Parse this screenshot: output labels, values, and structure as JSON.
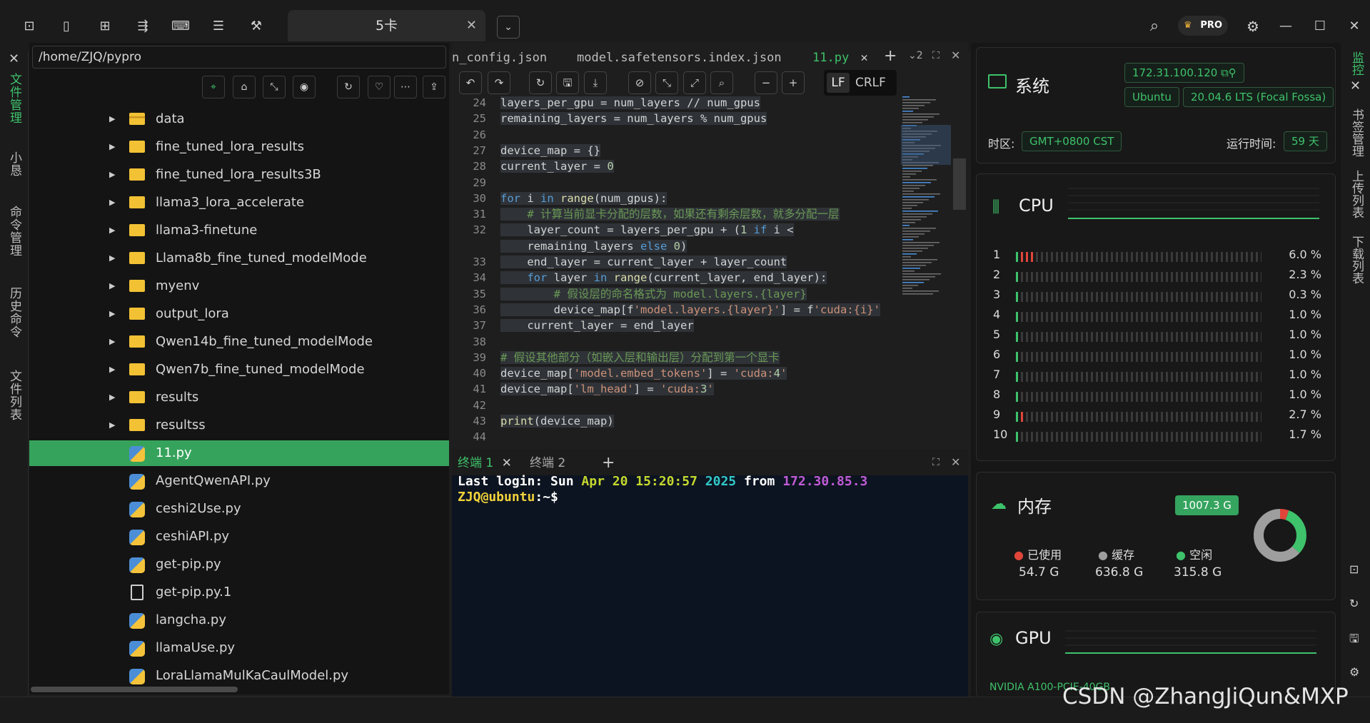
{
  "topbar": {
    "icons": [
      "terminal-icon",
      "bookmark-icon",
      "grid-icon",
      "tree-icon",
      "console-icon",
      "list-icon",
      "wrench-icon"
    ],
    "tab_label": "5卡",
    "tab_close": "✕",
    "menu_toggle": "⌄",
    "right_icons": [
      "search-icon",
      "pro-badge",
      "gear-icon",
      "minimize-icon",
      "maximize-icon",
      "close-icon"
    ],
    "pro_label": "PRO"
  },
  "left_rail": {
    "close": "✕",
    "items": [
      "文件管理",
      "小恳",
      "命令管理",
      "历史命令",
      "文件列表"
    ]
  },
  "file_panel": {
    "path": "/home/ZJQ/pypro",
    "toolbar": [
      "⌖",
      "⌂",
      "⤡",
      "◉",
      "↻",
      "♡",
      "⋯",
      "⇪"
    ],
    "items": [
      {
        "name": "data",
        "type": "db"
      },
      {
        "name": "fine_tuned_lora_results",
        "type": "folder"
      },
      {
        "name": "fine_tuned_lora_results3B",
        "type": "folder"
      },
      {
        "name": "llama3_lora_accelerate",
        "type": "folder"
      },
      {
        "name": "llama3-finetune",
        "type": "folder"
      },
      {
        "name": "Llama8b_fine_tuned_modelMode",
        "type": "folder"
      },
      {
        "name": "myenv",
        "type": "folder"
      },
      {
        "name": "output_lora",
        "type": "folder"
      },
      {
        "name": "Qwen14b_fine_tuned_modelMode",
        "type": "folder"
      },
      {
        "name": "Qwen7b_fine_tuned_modelMode",
        "type": "folder"
      },
      {
        "name": "results",
        "type": "folder"
      },
      {
        "name": "resultss",
        "type": "folder"
      },
      {
        "name": "11.py",
        "type": "py",
        "selected": true
      },
      {
        "name": "AgentQwenAPI.py",
        "type": "py"
      },
      {
        "name": "ceshi2Use.py",
        "type": "py"
      },
      {
        "name": "ceshiAPI.py",
        "type": "py"
      },
      {
        "name": "get-pip.py",
        "type": "py"
      },
      {
        "name": "get-pip.py.1",
        "type": "doc"
      },
      {
        "name": "langcha.py",
        "type": "py"
      },
      {
        "name": "llamaUse.py",
        "type": "py"
      },
      {
        "name": "LoraLlamaMulKaCaulModel.py",
        "type": "py"
      }
    ]
  },
  "editor": {
    "tabs": [
      "n_config.json",
      "model.safetensors.index.json",
      "11.py"
    ],
    "tab_close": "✕",
    "add": "+",
    "split": "⌄2",
    "expand": "⛶",
    "close": "✕",
    "toolbar": [
      "↶",
      "↷",
      "↻",
      "🖫",
      "⤓",
      "⊘",
      "⤡",
      "⤢",
      "⌕",
      "−",
      "+"
    ],
    "eol": [
      "LF",
      "CRLF"
    ],
    "lines": {
      "24": "layers_per_gpu = num_layers // num_gpus",
      "25": "remaining_layers = num_layers % num_gpus",
      "27": "device_map = {}",
      "28": "current_layer = 0",
      "30": "for i in range(num_gpus):",
      "31": "    # 计算当前显卡分配的层数，如果还有剩余层数，就多分配一层",
      "32a": "    layer_count = layers_per_gpu + (1 if i <",
      "32b": "    remaining_layers else 0)",
      "33": "    end_layer = current_layer + layer_count",
      "34": "    for layer in range(current_layer, end_layer):",
      "35": "        # 假设层的命名格式为 model.layers.{layer}",
      "36": "        device_map[f'model.layers.{layer}'] = f'cuda:{i}'",
      "37": "    current_layer = end_layer",
      "39": "# 假设其他部分（如嵌入层和输出层）分配到第一个显卡",
      "40": "device_map['model.embed_tokens'] = 'cuda:4'",
      "41": "device_map['lm_head'] = 'cuda:3'",
      "43": "print(device_map)"
    },
    "line_numbers": [
      "24",
      "25",
      "26",
      "27",
      "28",
      "29",
      "30",
      "31",
      "32",
      "",
      "33",
      "34",
      "35",
      "36",
      "37",
      "38",
      "39",
      "40",
      "41",
      "42",
      "43",
      "44"
    ]
  },
  "terminal": {
    "tabs": [
      "终端 1",
      "终端 2"
    ],
    "close": "✕",
    "add": "+",
    "login_prefix": "Last login: Sun ",
    "login_date": "Apr 20 15:20:57",
    "login_year": "2025",
    "login_from": " from ",
    "login_ip": "172.30.85.3",
    "prompt_user": "ZJQ@ubuntu",
    "prompt_path": ":~$"
  },
  "monitor": {
    "system_title": "系统",
    "ip": "172.31.100.120",
    "os": "Ubuntu",
    "os_version": "20.04.6 LTS (Focal Fossa)",
    "tz_label": "时区:",
    "tz_value": "GMT+0800  CST",
    "uptime_label": "运行时间:",
    "uptime_value": "59 天",
    "cpu_title": "CPU",
    "cpu_cores": [
      {
        "id": "1",
        "pct": "6.0 %",
        "level": 0.06,
        "hot": true
      },
      {
        "id": "2",
        "pct": "2.3 %",
        "level": 0.023,
        "hot": true
      },
      {
        "id": "3",
        "pct": "0.3 %",
        "level": 0.003,
        "hot": false
      },
      {
        "id": "4",
        "pct": "1.0 %",
        "level": 0.01,
        "hot": false
      },
      {
        "id": "5",
        "pct": "1.0 %",
        "level": 0.01,
        "hot": false
      },
      {
        "id": "6",
        "pct": "1.0 %",
        "level": 0.01,
        "hot": true
      },
      {
        "id": "7",
        "pct": "1.0 %",
        "level": 0.01,
        "hot": false
      },
      {
        "id": "8",
        "pct": "1.0 %",
        "level": 0.01,
        "hot": false
      },
      {
        "id": "9",
        "pct": "2.7 %",
        "level": 0.027,
        "hot": true
      },
      {
        "id": "10",
        "pct": "1.7 %",
        "level": 0.017,
        "hot": false
      }
    ],
    "mem_title": "内存",
    "mem_total": "1007.3 G",
    "mem_used_label": "已使用",
    "mem_used": "54.7 G",
    "mem_cache_label": "缓存",
    "mem_cache": "636.8 G",
    "mem_free_label": "空闲",
    "mem_free": "315.8 G",
    "gpu_title": "GPU",
    "gpu_name": "NVIDIA A100-PCIE-40GB"
  },
  "right_rail": {
    "items": [
      "监控",
      "书签管理",
      "上传列表",
      "下载列表"
    ],
    "close": "✕"
  },
  "watermark": "CSDN @ZhangJiQun&MXP",
  "colors": {
    "accent": "#3ec26b",
    "selected_row": "#36a35c",
    "used": "#e0453a",
    "cache": "#9e9e9e"
  }
}
